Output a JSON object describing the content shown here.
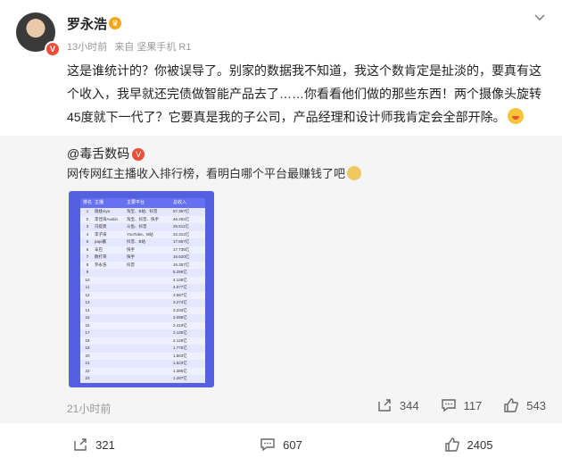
{
  "user": {
    "name": "罗永浩",
    "time": "13小时前",
    "source": "来自 坚果手机 R1"
  },
  "post": {
    "text": "这是谁统计的？你被误导了。别家的数据我不知道，我这个数肯定是扯淡的，要真有这个收入，我早就还完债做智能产品去了……你看看他们做的那些东西！两个摄像头旋转45度就下一代了？它要真是我的子公司，产品经理和设计师我肯定会全部开除。"
  },
  "repost": {
    "author": "@毒舌数码",
    "text": "网传网红主播收入排行榜，看明白哪个平台最赚钱了吧",
    "time": "21小时前",
    "shares": "344",
    "comments": "117",
    "likes": "543"
  },
  "ranking": {
    "headers": [
      "排名",
      "主播",
      "主要平台",
      "总收入"
    ],
    "rows": [
      [
        "1",
        "薇娅viya",
        "淘宝、B站、抖音",
        "57.357亿"
      ],
      [
        "2",
        "李佳琦Austin",
        "淘宝、抖音、快手",
        "46.292亿"
      ],
      [
        "3",
        "冯提莫",
        "斗鱼、抖音",
        "25.511亿"
      ],
      [
        "4",
        "李子柒",
        "YouTube、B站",
        "22.314亿"
      ],
      [
        "5",
        "papi酱",
        "抖音、B站",
        "17.557亿"
      ],
      [
        "6",
        "辛巴",
        "快手",
        "17.735亿"
      ],
      [
        "7",
        "散打哥",
        "快手",
        "16.520亿"
      ],
      [
        "8",
        "罗永浩",
        "抖音",
        "15.357亿"
      ],
      [
        "9",
        "",
        "",
        "5.296亿"
      ],
      [
        "10",
        "",
        "",
        "4.139亿"
      ],
      [
        "11",
        "",
        "",
        "4.077亿"
      ],
      [
        "12",
        "",
        "",
        "3.587亿"
      ],
      [
        "13",
        "",
        "",
        "3.274亿"
      ],
      [
        "14",
        "",
        "",
        "3.233亿"
      ],
      [
        "15",
        "",
        "",
        "3.098亿"
      ],
      [
        "16",
        "",
        "",
        "2.419亿"
      ],
      [
        "17",
        "",
        "",
        "2.135亿"
      ],
      [
        "18",
        "",
        "",
        "2.126亿"
      ],
      [
        "19",
        "",
        "",
        "1.776亿"
      ],
      [
        "20",
        "",
        "",
        "1.563亿"
      ],
      [
        "21",
        "",
        "",
        "1.523亿"
      ],
      [
        "22",
        "",
        "",
        "1.385亿"
      ],
      [
        "23",
        "",
        "",
        "1.287亿"
      ]
    ]
  },
  "footer": {
    "shares": "321",
    "comments": "607",
    "likes": "2405"
  }
}
